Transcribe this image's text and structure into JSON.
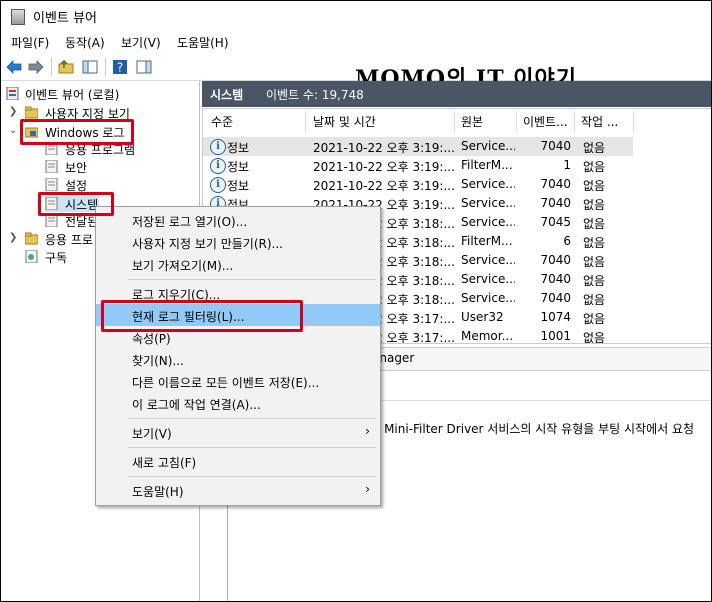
{
  "window": {
    "title": "이벤트 뷰어"
  },
  "menu": [
    "파일(F)",
    "동작(A)",
    "보기(V)",
    "도움말(H)"
  ],
  "watermark": "MOMO의 IT 이야기",
  "tree": {
    "root": "이벤트 뷰어 (로컬)",
    "custom_views": "사용자 지정 보기",
    "windows_logs": "Windows 로그",
    "application": "응용 프로그램",
    "security": "보안",
    "setup": "설정",
    "system": "시스템",
    "forwarded": "전달된",
    "apps_services": "응용 프로",
    "subscriptions": "구독"
  },
  "panel": {
    "title": "시스템",
    "event_count": "이벤트 수: 19,748"
  },
  "columns": [
    "수준",
    "날짜 및 시간",
    "원본",
    "이벤트...",
    "작업 ..."
  ],
  "rows": [
    {
      "level": "정보",
      "datetime": "2021-10-22 오후 3:19:...",
      "source": "Service...",
      "event_id": "7040",
      "task": "없음"
    },
    {
      "level": "정보",
      "datetime": "2021-10-22 오후 3:19:...",
      "source": "FilterM...",
      "event_id": "1",
      "task": "없음"
    },
    {
      "level": "정보",
      "datetime": "2021-10-22 오후 3:19:...",
      "source": "Service...",
      "event_id": "7040",
      "task": "없음"
    },
    {
      "level": "정보",
      "datetime": "2021-10-22 오후 3:19:...",
      "source": "Service...",
      "event_id": "7040",
      "task": "없음"
    },
    {
      "level": "",
      "datetime": "2021-10-22 오후 3:18:...",
      "source": "Service...",
      "event_id": "7045",
      "task": "없음"
    },
    {
      "level": "",
      "datetime": "2021-10-22 오후 3:18:...",
      "source": "FilterM...",
      "event_id": "6",
      "task": "없음"
    },
    {
      "level": "",
      "datetime": "2021-10-22 오후 3:18:...",
      "source": "Service...",
      "event_id": "7040",
      "task": "없음"
    },
    {
      "level": "",
      "datetime": "2021-10-22 오후 3:18:...",
      "source": "Service...",
      "event_id": "7040",
      "task": "없음"
    },
    {
      "level": "",
      "datetime": "2021-10-22 오후 3:18:...",
      "source": "Service...",
      "event_id": "7040",
      "task": "없음"
    },
    {
      "level": "",
      "datetime": "2021-10-22 오후 3:17:...",
      "source": "User32",
      "event_id": "1074",
      "task": "없음"
    },
    {
      "level": "",
      "datetime": "2021-10-22 오후 3:17:...",
      "source": "Memor...",
      "event_id": "1001",
      "task": "없음"
    }
  ],
  "detail": {
    "source_fragment": "anager",
    "message_fragment": "s Mini-Filter Driver 서비스의 시작 유형을 부팅 시작에서 요청"
  },
  "context_menu": {
    "items": [
      {
        "label": "저장된 로그 열기(O)..."
      },
      {
        "label": "사용자 지정 보기 만들기(R)..."
      },
      {
        "label": "보기 가져오기(M)..."
      },
      {
        "label": "로그 지우기(C)..."
      },
      {
        "label": "현재 로그 필터링(L)..."
      },
      {
        "label": "속성(P)"
      },
      {
        "label": "찾기(N)..."
      },
      {
        "label": "다른 이름으로 모든 이벤트 저장(E)..."
      },
      {
        "label": "이 로그에 작업 연결(A)..."
      },
      {
        "label": "보기(V)",
        "arrow": "›"
      },
      {
        "label": "새로 고침(F)"
      },
      {
        "label": "도움말(H)",
        "arrow": "›"
      }
    ]
  },
  "colors": {
    "highlight_red": "#d4001a",
    "menu_hover": "#91c9f7",
    "panel_header": "#4a5566",
    "info_blue": "#1e5fa8"
  }
}
